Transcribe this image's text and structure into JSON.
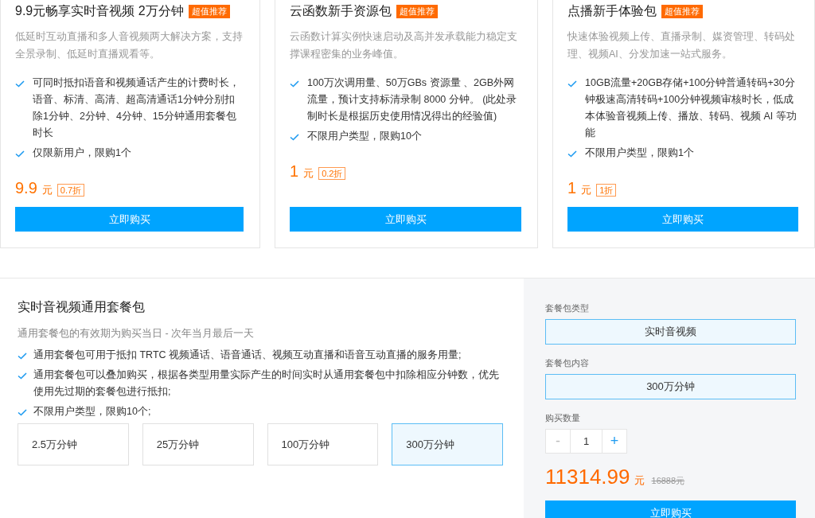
{
  "cards": [
    {
      "title": "9.9元畅享实时音视频 2万分钟",
      "badge": "超值推荐",
      "description": "低延时互动直播和多人音视频两大解决方案，支持全景录制、低延时直播观看等。",
      "features": [
        "可同时抵扣语音和视频通话产生的计费时长，语音、标清、高清、超高清通话1分钟分别扣除1分钟、2分钟、4分钟、15分钟通用套餐包时长",
        "仅限新用户，限购1个"
      ],
      "price": "9.9",
      "unit": "元",
      "discount": "0.7折",
      "button": "立即购买"
    },
    {
      "title": "云函数新手资源包",
      "badge": "超值推荐",
      "description": "云函数计算实例快速启动及高并发承载能力稳定支撑课程密集的业务峰值。",
      "features": [
        "100万次调用量、50万GBs 资源量 、2GB外网流量，预计支持标清录制 8000 分钟。 (此处录制时长是根据历史使用情况得出的经验值)",
        "不限用户类型，限购10个"
      ],
      "price": "1",
      "unit": "元",
      "discount": "0.2折",
      "button": "立即购买"
    },
    {
      "title": "点播新手体验包",
      "badge": "超值推荐",
      "description": "快速体验视频上传、直播录制、媒资管理、转码处理、视频AI、分发加速一站式服务。",
      "features": [
        "10GB流量+20GB存储+100分钟普通转码+30分钟极速高清转码+100分钟视频审核时长，低成本体验音视频上传、播放、转码、视频 AI 等功能",
        "不限用户类型，限购1个"
      ],
      "price": "1",
      "unit": "元",
      "discount": "1折",
      "button": "立即购买"
    }
  ],
  "package": {
    "title": "实时音视频通用套餐包",
    "validity": "通用套餐包的有效期为购买当日 - 次年当月最后一天",
    "features": [
      "通用套餐包可用于抵扣 TRTC 视频通话、语音通话、视频互动直播和语音互动直播的服务用量;",
      "通用套餐包可以叠加购买，根据各类型用量实际产生的时间实时从通用套餐包中扣除相应分钟数，优先使用先过期的套餐包进行抵扣;",
      "不限用户类型，限购10个;"
    ],
    "options": [
      {
        "label": "2.5万分钟",
        "selected": false
      },
      {
        "label": "25万分钟",
        "selected": false
      },
      {
        "label": "100万分钟",
        "selected": false
      },
      {
        "label": "300万分钟",
        "selected": true
      }
    ]
  },
  "order_panel": {
    "type_label": "套餐包类型",
    "type_value": "实时音视频",
    "content_label": "套餐包内容",
    "content_value": "300万分钟",
    "quantity_label": "购买数量",
    "decrement": "-",
    "quantity": "1",
    "increment": "+",
    "price": "11314.99",
    "unit": "元",
    "original_price": "16888元",
    "button": "立即购买"
  }
}
